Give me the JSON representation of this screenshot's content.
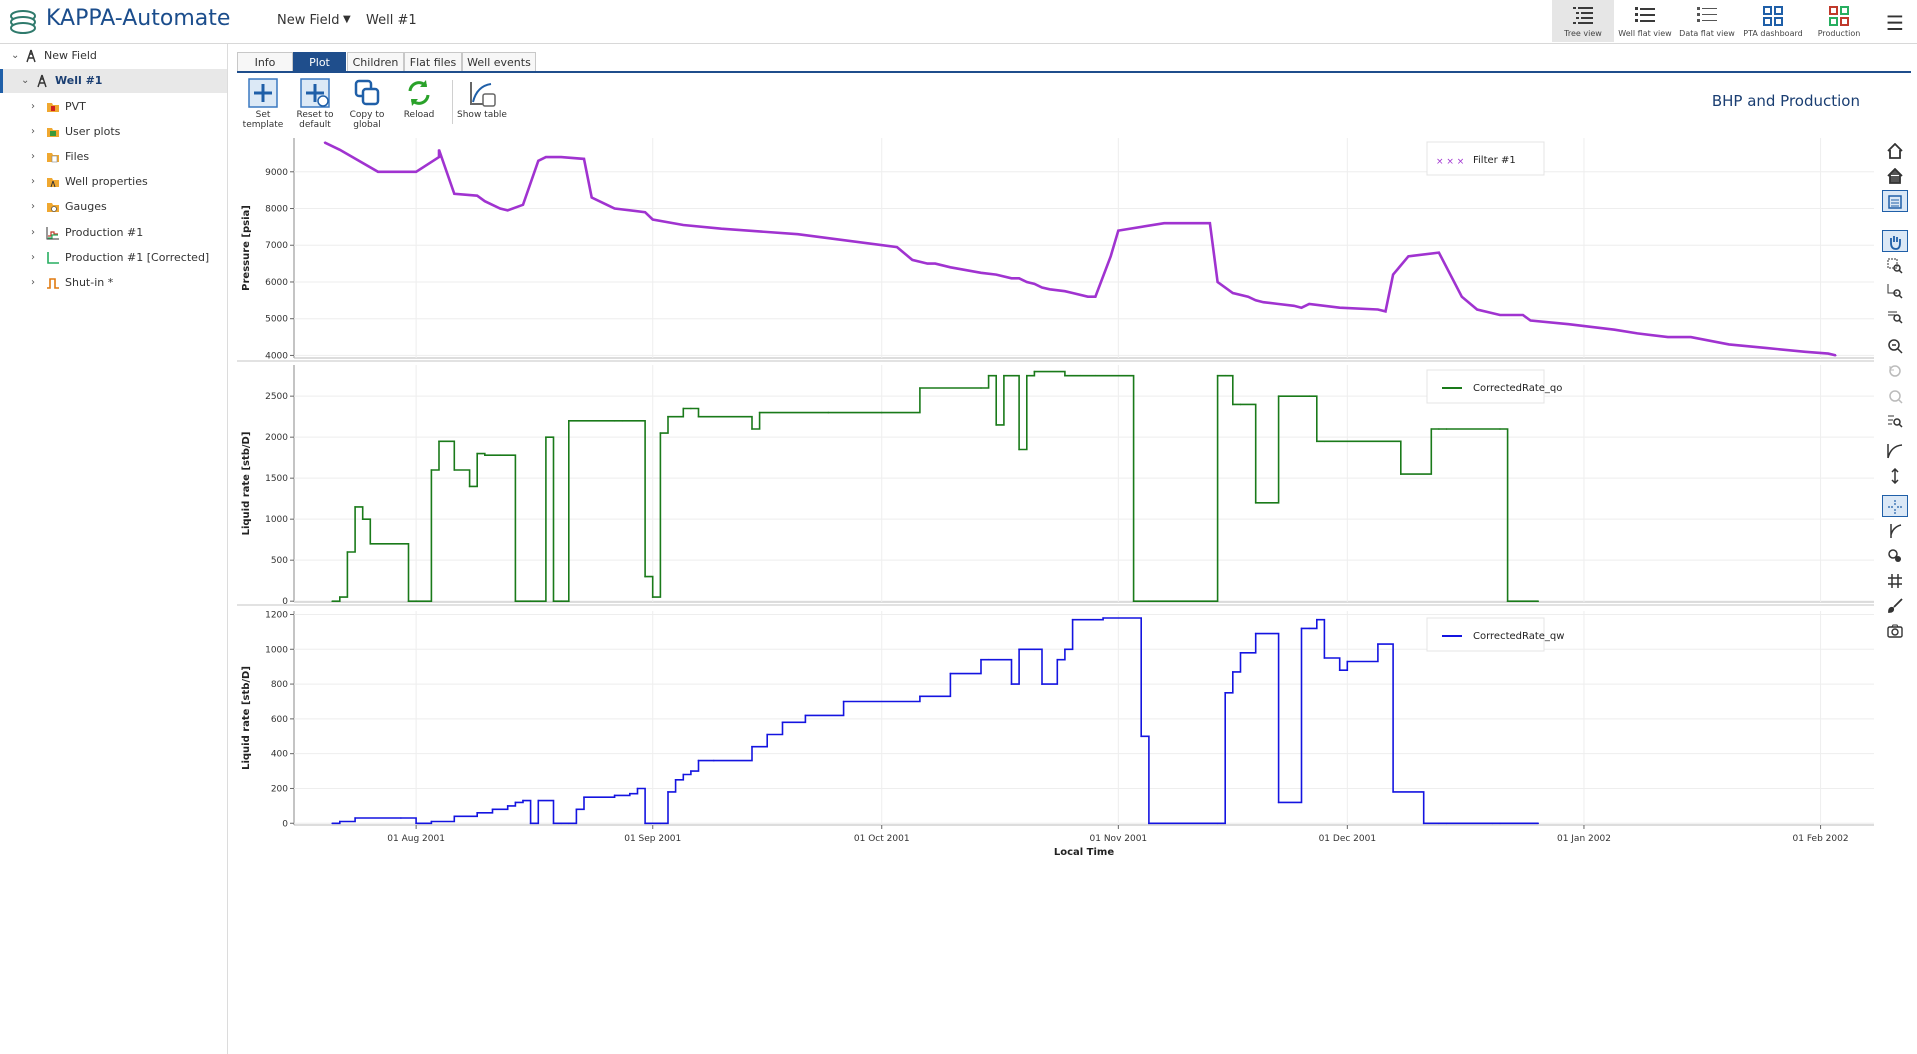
{
  "app": {
    "title": "KAPPA-Automate"
  },
  "header": {
    "field_select": "New Field",
    "breadcrumb": "Well #1"
  },
  "views": [
    {
      "label": "Tree view",
      "icon": "tree-view-icon",
      "active": true
    },
    {
      "label": "Well flat view",
      "icon": "well-flat-view-icon",
      "active": false
    },
    {
      "label": "Data flat view",
      "icon": "data-flat-view-icon",
      "active": false
    },
    {
      "label": "PTA dashboard",
      "icon": "pta-dashboard-icon",
      "active": false
    },
    {
      "label": "Production",
      "icon": "production-icon",
      "active": false
    }
  ],
  "sidebar": {
    "items": [
      {
        "label": "New Field",
        "icon": "field-icon",
        "level": 0,
        "expanded": true
      },
      {
        "label": "Well #1",
        "icon": "well-icon",
        "level": 1,
        "expanded": true,
        "selected": true
      },
      {
        "label": "PVT",
        "icon": "pvt-folder-icon",
        "level": 2
      },
      {
        "label": "User plots",
        "icon": "user-plots-folder-icon",
        "level": 2
      },
      {
        "label": "Files",
        "icon": "files-folder-icon",
        "level": 2
      },
      {
        "label": "Well properties",
        "icon": "well-properties-folder-icon",
        "level": 2
      },
      {
        "label": "Gauges",
        "icon": "gauges-folder-icon",
        "level": 2
      },
      {
        "label": "Production #1",
        "icon": "production-data-icon",
        "level": 2
      },
      {
        "label": "Production #1 [Corrected]",
        "icon": "corrected-production-icon",
        "level": 2
      },
      {
        "label": "Shut-in *",
        "icon": "shut-in-icon",
        "level": 2
      }
    ]
  },
  "tabs": [
    {
      "label": "Info",
      "active": false
    },
    {
      "label": "Plot",
      "active": true
    },
    {
      "label": "Children",
      "active": false
    },
    {
      "label": "Flat files",
      "active": false
    },
    {
      "label": "Well events",
      "active": false
    }
  ],
  "toolbar": {
    "set_template": [
      "Set",
      "template"
    ],
    "reset_default": [
      "Reset to",
      "default"
    ],
    "copy_global": [
      "Copy to",
      "global"
    ],
    "reload": [
      "Reload"
    ],
    "show_table": [
      "Show table"
    ]
  },
  "plot_title": "BHP and Production",
  "colors": {
    "pressure": "#a033d0",
    "qo": "#1a7a1a",
    "qw": "#1414e0",
    "accent": "#1f4e8c"
  },
  "chart_data": [
    {
      "type": "line",
      "ylabel": "Pressure [psia]",
      "ylim": [
        3930,
        9920
      ],
      "yticks": [
        4000,
        5000,
        6000,
        7000,
        8000,
        9000
      ],
      "legend": "Filter #1",
      "legend_position": "top-right",
      "series": [
        {
          "name": "Filter #1",
          "x": [
            "2001-07-20",
            "2001-07-22",
            "2001-07-27",
            "2001-08-01",
            "2001-08-04",
            "2001-08-04",
            "2001-08-06",
            "2001-08-09",
            "2001-08-10",
            "2001-08-12",
            "2001-08-13",
            "2001-08-15",
            "2001-08-17",
            "2001-08-18",
            "2001-08-20",
            "2001-08-23",
            "2001-08-24",
            "2001-08-26",
            "2001-08-27",
            "2001-08-31",
            "2001-09-01",
            "2001-09-05",
            "2001-09-10",
            "2001-09-20",
            "2001-10-03",
            "2001-10-05",
            "2001-10-07",
            "2001-10-08",
            "2001-10-10",
            "2001-10-14",
            "2001-10-16",
            "2001-10-18",
            "2001-10-19",
            "2001-10-20",
            "2001-10-21",
            "2001-10-22",
            "2001-10-23",
            "2001-10-25",
            "2001-10-26",
            "2001-10-28",
            "2001-10-29",
            "2001-10-31",
            "2001-11-01",
            "2001-11-07",
            "2001-11-13",
            "2001-11-14",
            "2001-11-16",
            "2001-11-18",
            "2001-11-19",
            "2001-11-20",
            "2001-11-22",
            "2001-11-24",
            "2001-11-25",
            "2001-11-26",
            "2001-11-30",
            "2001-12-05",
            "2001-12-06",
            "2001-12-07",
            "2001-12-09",
            "2001-12-13",
            "2001-12-16",
            "2001-12-18",
            "2001-12-21",
            "2001-12-24",
            "2001-12-25",
            "2001-12-30",
            "2002-01-05",
            "2002-01-08",
            "2002-01-12",
            "2002-01-15",
            "2002-01-20",
            "2002-01-25",
            "2002-01-30",
            "2002-02-02",
            "2002-02-03"
          ],
          "y": [
            9800,
            9600,
            9000,
            9000,
            9400,
            9600,
            8400,
            8350,
            8200,
            8000,
            7950,
            8100,
            9300,
            9400,
            9400,
            9350,
            8300,
            8100,
            8000,
            7900,
            7700,
            7550,
            7450,
            7300,
            6950,
            6600,
            6500,
            6500,
            6400,
            6250,
            6200,
            6100,
            6100,
            6000,
            5950,
            5850,
            5800,
            5750,
            5700,
            5600,
            5600,
            6700,
            7400,
            7600,
            7600,
            6000,
            5700,
            5600,
            5500,
            5450,
            5400,
            5350,
            5300,
            5400,
            5300,
            5250,
            5200,
            6200,
            6700,
            6800,
            5600,
            5250,
            5100,
            5100,
            4950,
            4850,
            4700,
            4600,
            4500,
            4500,
            4300,
            4200,
            4100,
            4050,
            4000
          ]
        }
      ]
    },
    {
      "type": "line",
      "ylabel": "Liquid rate [stb/D]",
      "ylim": [
        -10,
        2880
      ],
      "yticks": [
        0,
        500,
        1000,
        1500,
        2000,
        2500
      ],
      "legend": "CorrectedRate_qo",
      "legend_position": "top-right",
      "series": [
        {
          "name": "CorrectedRate_qo",
          "x": [
            "2001-07-21",
            "2001-07-22",
            "2001-07-23",
            "2001-07-24",
            "2001-07-25",
            "2001-07-26",
            "2001-07-31",
            "2001-08-01",
            "2001-08-03",
            "2001-08-04",
            "2001-08-06",
            "2001-08-08",
            "2001-08-09",
            "2001-08-10",
            "2001-08-12",
            "2001-08-14",
            "2001-08-16",
            "2001-08-18",
            "2001-08-19",
            "2001-08-20",
            "2001-08-21",
            "2001-08-21",
            "2001-08-27",
            "2001-08-28",
            "2001-08-31",
            "2001-09-01",
            "2001-09-02",
            "2001-09-03",
            "2001-09-05",
            "2001-09-05",
            "2001-09-06",
            "2001-09-07",
            "2001-09-14",
            "2001-09-15",
            "2001-09-24",
            "2001-10-01",
            "2001-10-06",
            "2001-10-14",
            "2001-10-15",
            "2001-10-16",
            "2001-10-17",
            "2001-10-19",
            "2001-10-20",
            "2001-10-21",
            "2001-10-25",
            "2001-10-27",
            "2001-10-29",
            "2001-11-03",
            "2001-11-05",
            "2001-11-14",
            "2001-11-15",
            "2001-11-16",
            "2001-11-17",
            "2001-11-19",
            "2001-11-22",
            "2001-11-26",
            "2001-11-27",
            "2001-11-28",
            "2001-12-08",
            "2001-12-12",
            "2001-12-13",
            "2001-12-14",
            "2001-12-21",
            "2001-12-22",
            "2001-12-26"
          ],
          "y": [
            0,
            50,
            600,
            1150,
            1000,
            700,
            0,
            0,
            1600,
            1950,
            1600,
            1400,
            1800,
            1780,
            1780,
            0,
            0,
            2000,
            0,
            0,
            0,
            2200,
            2200,
            2200,
            300,
            50,
            2050,
            2250,
            2350,
            2350,
            2350,
            2250,
            2100,
            2300,
            2300,
            2300,
            2600,
            2600,
            2750,
            2150,
            2750,
            1850,
            2750,
            2800,
            2750,
            2750,
            2750,
            0,
            0,
            2750,
            2750,
            2400,
            2400,
            1200,
            2500,
            2500,
            1950,
            1950,
            1550,
            2100,
            2100,
            2100,
            2100,
            0,
            0
          ],
          "note": "step series"
        }
      ]
    },
    {
      "type": "line",
      "ylabel": "Liquid rate [stb/D]",
      "xlabel": "Local Time",
      "ylim": [
        -10,
        1220
      ],
      "yticks": [
        0,
        200,
        400,
        600,
        800,
        1000,
        1200
      ],
      "xticks": [
        "01 Aug 2001",
        "01 Sep 2001",
        "01 Oct 2001",
        "01 Nov 2001",
        "01 Dec 2001",
        "01 Jan 2002",
        "01 Feb 2002"
      ],
      "legend": "CorrectedRate_qw",
      "legend_position": "top-right",
      "series": [
        {
          "name": "CorrectedRate_qw",
          "x": [
            "2001-07-21",
            "2001-07-22",
            "2001-07-24",
            "2001-07-30",
            "2001-08-01",
            "2001-08-03",
            "2001-08-06",
            "2001-08-09",
            "2001-08-11",
            "2001-08-13",
            "2001-08-14",
            "2001-08-15",
            "2001-08-16",
            "2001-08-17",
            "2001-08-19",
            "2001-08-20",
            "2001-08-21",
            "2001-08-22",
            "2001-08-23",
            "2001-08-27",
            "2001-08-29",
            "2001-08-30",
            "2001-08-31",
            "2001-09-02",
            "2001-09-03",
            "2001-09-04",
            "2001-09-05",
            "2001-09-06",
            "2001-09-07",
            "2001-09-09",
            "2001-09-14",
            "2001-09-16",
            "2001-09-18",
            "2001-09-21",
            "2001-09-26",
            "2001-10-06",
            "2001-10-10",
            "2001-10-14",
            "2001-10-15",
            "2001-10-18",
            "2001-10-19",
            "2001-10-21",
            "2001-10-22",
            "2001-10-24",
            "2001-10-25",
            "2001-10-26",
            "2001-10-30",
            "2001-11-04",
            "2001-11-05",
            "2001-11-14",
            "2001-11-15",
            "2001-11-16",
            "2001-11-17",
            "2001-11-19",
            "2001-11-22",
            "2001-11-25",
            "2001-11-26",
            "2001-11-27",
            "2001-11-28",
            "2001-11-30",
            "2001-12-01",
            "2001-12-05",
            "2001-12-07",
            "2001-12-11",
            "2001-12-13",
            "2001-12-14",
            "2001-12-20",
            "2001-12-21",
            "2001-12-26"
          ],
          "y": [
            0,
            10,
            30,
            30,
            0,
            10,
            40,
            60,
            80,
            100,
            120,
            130,
            0,
            130,
            0,
            0,
            0,
            80,
            150,
            160,
            170,
            200,
            0,
            0,
            180,
            250,
            280,
            300,
            360,
            360,
            440,
            510,
            580,
            620,
            700,
            730,
            860,
            940,
            940,
            800,
            1000,
            1000,
            800,
            940,
            1000,
            1170,
            1180,
            500,
            0,
            0,
            750,
            870,
            980,
            1090,
            120,
            1120,
            1120,
            1170,
            950,
            880,
            930,
            1030,
            180,
            0,
            0,
            0,
            0,
            0,
            0
          ],
          "note": "approximate step series"
        }
      ]
    }
  ]
}
